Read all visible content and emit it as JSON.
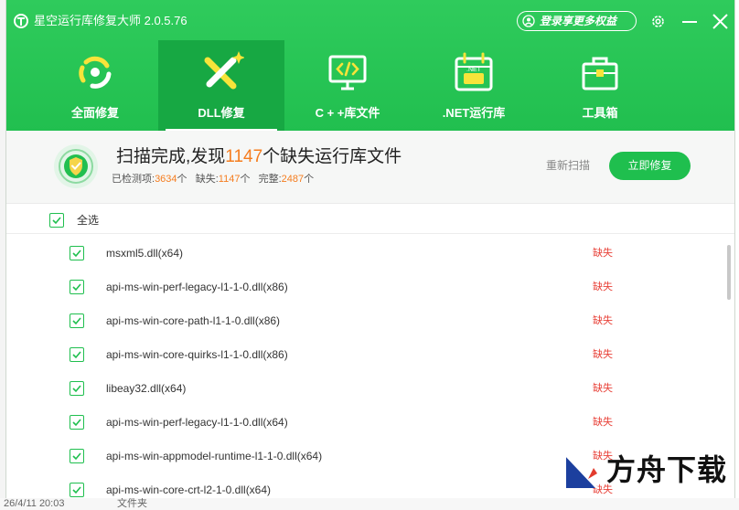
{
  "app": {
    "title": "星空运行库修复大师 2.0.5.76",
    "login_label": "登录享更多权益"
  },
  "tabs": [
    {
      "label": "全面修复",
      "icon": "cycle-icon"
    },
    {
      "label": "DLL修复",
      "icon": "tools-icon"
    },
    {
      "label": "C + +库文件",
      "icon": "code-monitor-icon"
    },
    {
      "label": ".NET运行库",
      "icon": "dotnet-calendar-icon"
    },
    {
      "label": "工具箱",
      "icon": "toolbox-icon"
    }
  ],
  "active_tab": 1,
  "scan": {
    "title_prefix": "扫描完成,发现",
    "missing_count": "1147",
    "title_suffix": "个缺失运行库文件",
    "checked_label": "已检测项:",
    "checked_count": "3634",
    "unit": "个",
    "missing_label": "缺失:",
    "complete_label": "完整:",
    "complete_count": "2487",
    "rescan_label": "重新扫描",
    "repair_label": "立即修复"
  },
  "select_all_label": "全选",
  "files": [
    {
      "name": "msxml5.dll(x64)",
      "status": "缺失"
    },
    {
      "name": "api-ms-win-perf-legacy-l1-1-0.dll(x86)",
      "status": "缺失"
    },
    {
      "name": "api-ms-win-core-path-l1-1-0.dll(x86)",
      "status": "缺失"
    },
    {
      "name": "api-ms-win-core-quirks-l1-1-0.dll(x86)",
      "status": "缺失"
    },
    {
      "name": "libeay32.dll(x64)",
      "status": "缺失"
    },
    {
      "name": "api-ms-win-perf-legacy-l1-1-0.dll(x64)",
      "status": "缺失"
    },
    {
      "name": "api-ms-win-appmodel-runtime-l1-1-0.dll(x64)",
      "status": "缺失"
    },
    {
      "name": "api-ms-win-core-crt-l2-1-0.dll(x64)",
      "status": "缺失"
    }
  ],
  "background": {
    "timestamp": "26/4/11 20:03",
    "type": "文件夹"
  },
  "watermark": {
    "text": "方舟下载"
  },
  "colors": {
    "brand_green": "#21bf4f",
    "active_tab": "#17a843",
    "accent_orange": "#f57d1f",
    "missing_red": "#e8433a"
  }
}
